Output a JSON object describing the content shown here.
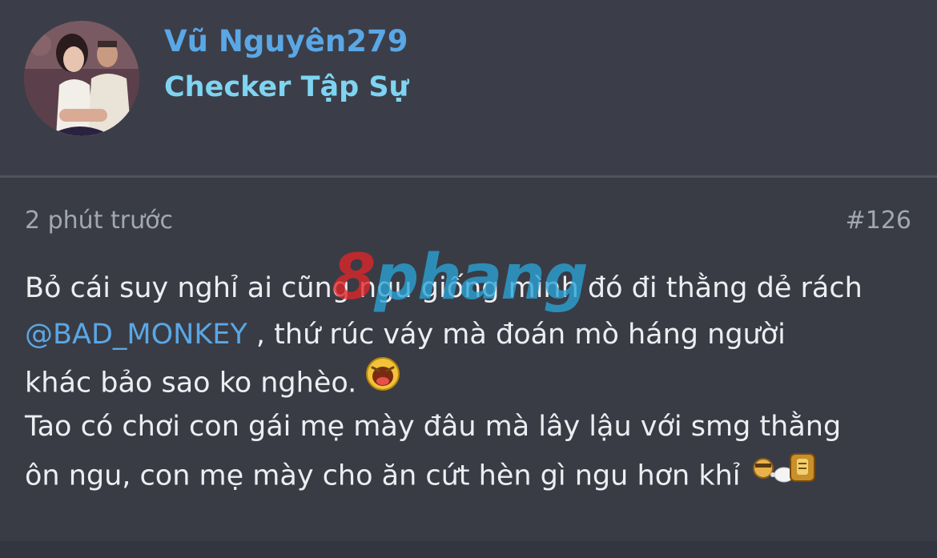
{
  "user": {
    "name": "Vũ Nguyên279",
    "rank": "Checker Tập Sự"
  },
  "post": {
    "timestamp": "2 phút trước",
    "number": "#126",
    "lines": {
      "l1": "Bỏ cái suy nghỉ ai cũng ngu giống mình đó đi thằng dẻ rách",
      "l2_mention": "@BAD_MONKEY",
      "l2_rest": " , thứ rúc váy mà đoán mò háng người",
      "l3": "khác bảo sao ko nghèo.",
      "l4": "Tao có chơi con gái mẹ mày đâu mà lây lậu với smg thằng",
      "l5": "ôn ngu, con mẹ mày cho ăn cứt hèn gì ngu hơn khỉ"
    },
    "emojis": [
      "laughing-emoji-icon",
      "fighting-emoji-icon"
    ]
  },
  "watermark": {
    "part1": "8",
    "part2": "phang"
  },
  "colors": {
    "background": "#3a3d46",
    "username": "#5aa7e6",
    "rank": "#7fd4f2",
    "text": "#eceef2",
    "muted": "#a3a7b0",
    "mention": "#5aa7e6"
  }
}
